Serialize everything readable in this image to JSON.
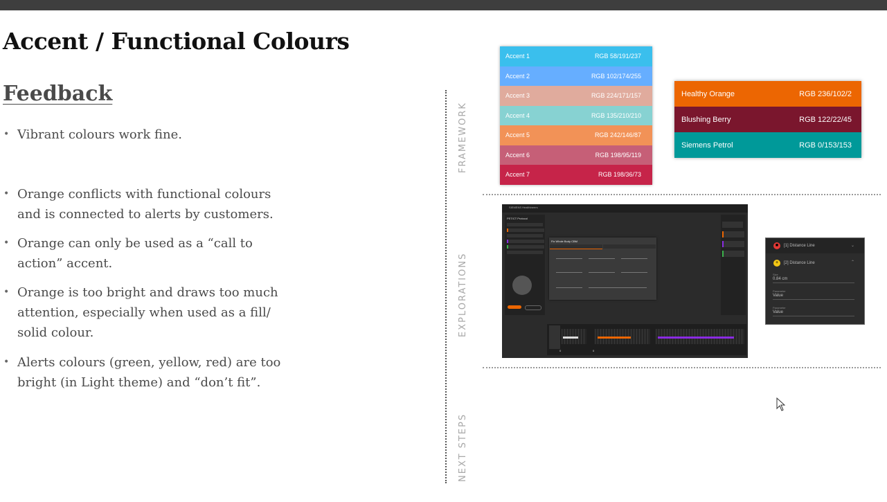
{
  "slide": {
    "title": "Accent / Functional Colours",
    "subtitle": "Feedback"
  },
  "feedback_bullets": [
    "Vibrant colours work fine.",
    "Orange conflicts with functional colours and is connected to alerts by customers.",
    "Orange can only be used as a “call to action” accent.",
    "Orange is too bright and draws too much attention, especially when used as a fill/ solid colour.",
    "Alerts colours (green, yellow, red) are too bright (in Light theme) and “don’t fit”."
  ],
  "section_labels": {
    "framework": "FRAMEWORK",
    "explorations": "EXPLORATIONS",
    "next_steps": "NEXT STEPS"
  },
  "accent_swatches": [
    {
      "name": "Accent 1",
      "value": "RGB 58/191/237",
      "color": "#3abfed"
    },
    {
      "name": "Accent 2",
      "value": "RGB 102/174/255",
      "color": "#66aeff"
    },
    {
      "name": "Accent 3",
      "value": "RGB 224/171/157",
      "color": "#e0ab9d"
    },
    {
      "name": "Accent 4",
      "value": "RGB 135/210/210",
      "color": "#87d2d2"
    },
    {
      "name": "Accent 5",
      "value": "RGB 242/146/87",
      "color": "#f29257"
    },
    {
      "name": "Accent 6",
      "value": "RGB 198/95/119",
      "color": "#c65f77"
    },
    {
      "name": "Accent 7",
      "value": "RGB 198/36/73",
      "color": "#c62449"
    }
  ],
  "functional_swatches": [
    {
      "name": "Healthy Orange",
      "value": "RGB 236/102/2",
      "color": "#ec6602"
    },
    {
      "name": "Blushing Berry",
      "value": "RGB 122/22/45",
      "color": "#7a162d"
    },
    {
      "name": "Siemens Petrol",
      "value": "RGB 0/153/153",
      "color": "#009999"
    }
  ],
  "exploration_app": {
    "brand": "SIEMENS Healthineers",
    "protocol_title": "PET/CT Protocol",
    "dialog_title": "Fix Whole Body CBM",
    "dialog_tabs": [
      "Follow",
      "Double Check"
    ],
    "right_title": "Recon Ranges",
    "timeline_ticks": [
      "0",
      "0"
    ]
  },
  "distance_panel": {
    "items": [
      {
        "label": "[1] Distance Line",
        "icon": "stop-icon",
        "color": "#e53935"
      },
      {
        "label": "[2] Distance Line",
        "icon": "plus-icon",
        "color": "#f3c614"
      }
    ],
    "fields": [
      {
        "label": "Size",
        "value": "0.84 cm"
      },
      {
        "label": "Parameter",
        "value": "Value"
      },
      {
        "label": "Parameter",
        "value": "Value"
      }
    ]
  }
}
